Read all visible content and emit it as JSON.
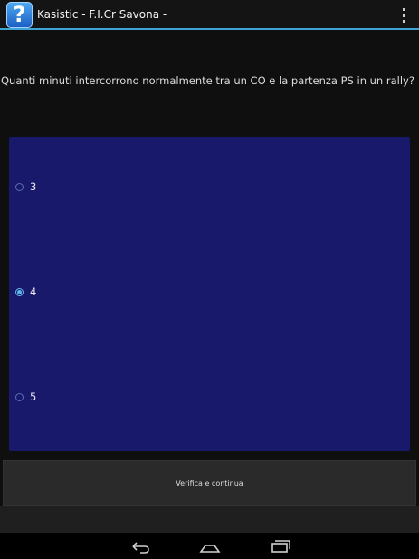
{
  "app": {
    "icon_glyph": "?",
    "title": "Kasistic - F.I.Cr Savona -",
    "accent_color": "#3fa3d6"
  },
  "quiz": {
    "question": "Quanti minuti intercorrono normalmente tra un CO e la partenza PS in un rally?",
    "options": [
      {
        "label": "3",
        "selected": false
      },
      {
        "label": "4",
        "selected": true
      },
      {
        "label": "5",
        "selected": false
      }
    ],
    "panel_color": "#19196b"
  },
  "actions": {
    "verify_label": "Verifica e continua"
  },
  "navbar": {
    "icons": [
      "back-icon",
      "home-icon",
      "recent-apps-icon"
    ]
  }
}
